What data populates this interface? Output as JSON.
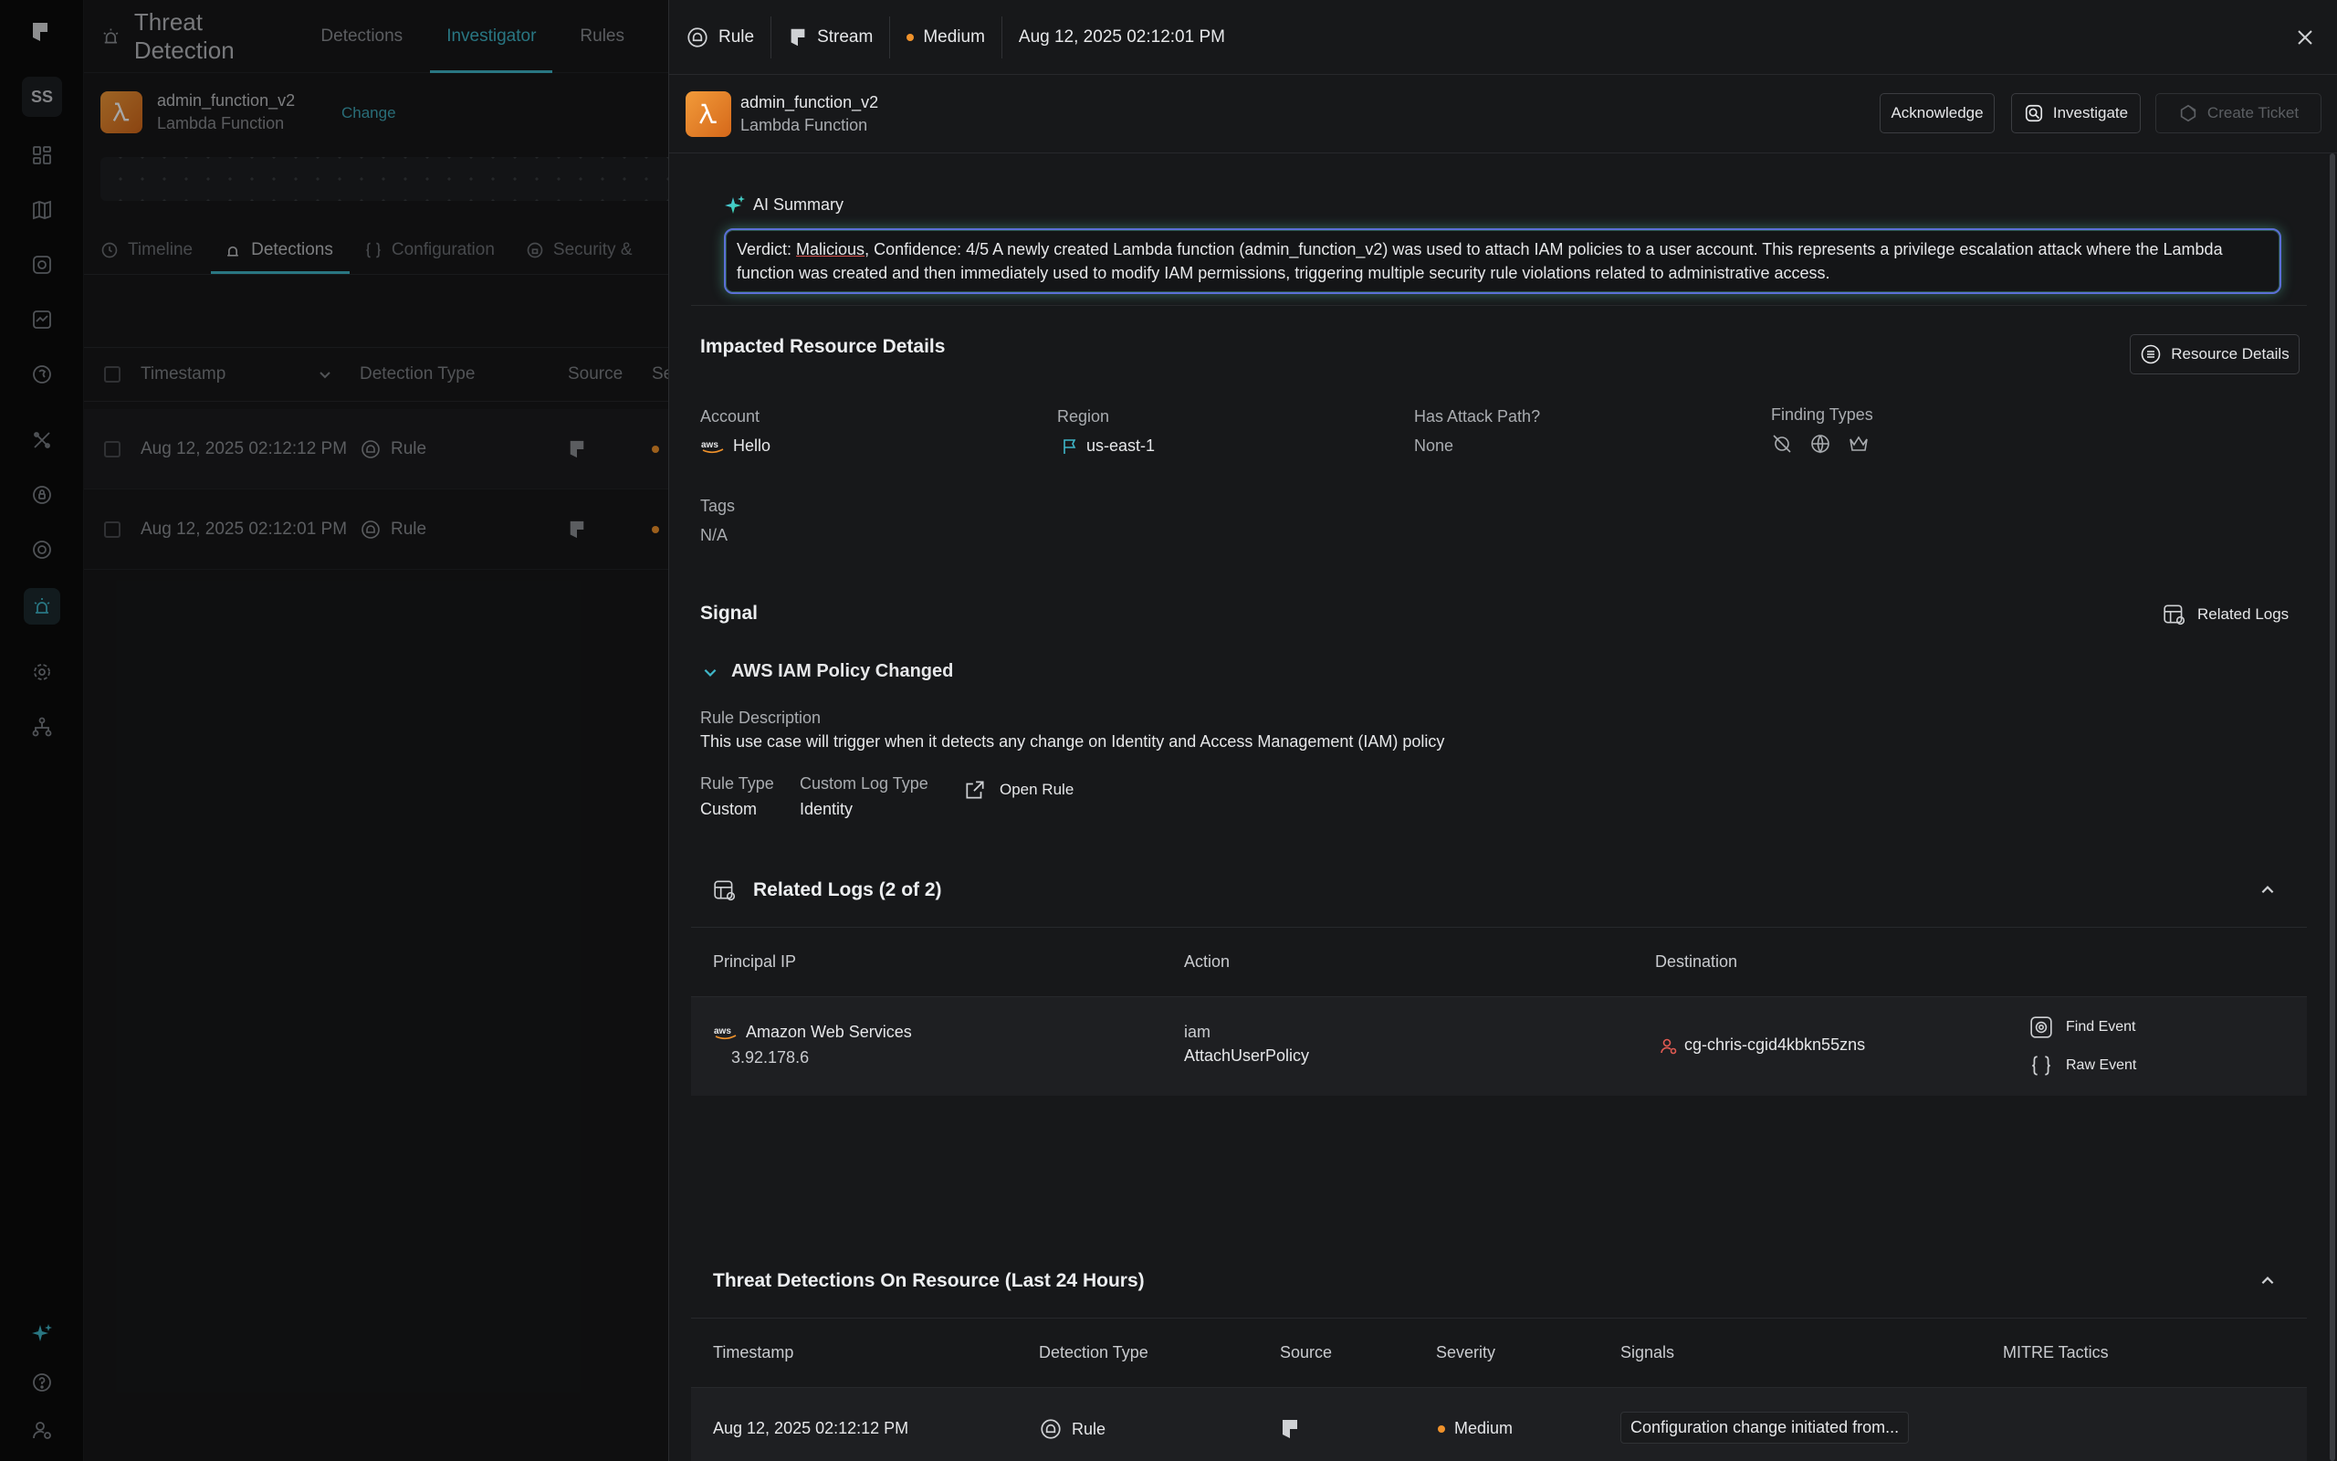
{
  "rail": {
    "avatar": "SS"
  },
  "background": {
    "app_title": "Threat Detection",
    "tabs": [
      "Detections",
      "Investigator",
      "Rules"
    ],
    "resource": {
      "name": "admin_function_v2",
      "type": "Lambda Function",
      "change": "Change"
    },
    "subtabs": [
      "Timeline",
      "Detections",
      "Configuration",
      "Security &"
    ],
    "table": {
      "columns": [
        "Timestamp",
        "Detection Type",
        "Source",
        "Se"
      ],
      "rows": [
        {
          "timestamp": "Aug 12, 2025 02:12:12 PM",
          "type": "Rule"
        },
        {
          "timestamp": "Aug 12, 2025 02:12:01 PM",
          "type": "Rule"
        }
      ]
    }
  },
  "drawer": {
    "top": {
      "kind": "Rule",
      "source": "Stream",
      "severity": "Medium",
      "timestamp": "Aug 12, 2025 02:12:01 PM"
    },
    "resource": {
      "name": "admin_function_v2",
      "type": "Lambda Function"
    },
    "buttons": {
      "acknowledge": "Acknowledge",
      "investigate": "Investigate",
      "create_ticket": "Create Ticket"
    },
    "ai": {
      "title": "AI Summary",
      "prefix": "Verdict: ",
      "verdict": "Malicious",
      "text": ", Confidence: 4/5 A newly created Lambda function (admin_function_v2) was used to attach IAM policies to a user account. This represents a privilege escalation attack where the Lambda function was created and then immediately used to modify IAM permissions, triggering multiple security rule violations related to administrative access."
    },
    "impacted": {
      "title": "Impacted Resource Details",
      "button": "Resource Details",
      "account_label": "Account",
      "account_value": "Hello",
      "region_label": "Region",
      "region_value": "us-east-1",
      "attack_label": "Has Attack Path?",
      "attack_value": "None",
      "finding_label": "Finding Types",
      "tags_label": "Tags",
      "tags_value": "N/A"
    },
    "signal": {
      "title": "Signal",
      "related_logs_button": "Related Logs",
      "name": "AWS IAM Policy Changed",
      "desc_label": "Rule Description",
      "desc_value": "This use case will trigger when it detects any change on Identity and Access Management (IAM) policy",
      "rule_type_label": "Rule Type",
      "rule_type_value": "Custom",
      "log_type_label": "Custom Log Type",
      "log_type_value": "Identity",
      "open_rule": "Open Rule"
    },
    "related_logs": {
      "title": "Related Logs (2 of 2)",
      "columns": [
        "Principal IP",
        "Action",
        "Destination"
      ],
      "row": {
        "principal": "Amazon Web Services",
        "ip": "3.92.178.6",
        "action_service": "iam",
        "action": "AttachUserPolicy",
        "destination": "cg-chris-cgid4kbkn55zns",
        "find_event": "Find Event",
        "raw_event": "Raw Event"
      }
    },
    "threats": {
      "title": "Threat Detections On Resource (Last 24 Hours)",
      "columns": [
        "Timestamp",
        "Detection Type",
        "Source",
        "Severity",
        "Signals",
        "MITRE Tactics"
      ],
      "row": {
        "timestamp": "Aug 12, 2025 02:12:12 PM",
        "type": "Rule",
        "severity": "Medium",
        "signals": "Configuration change initiated from..."
      }
    }
  },
  "colors": {
    "accent": "#3fb6c8",
    "severity_medium": "#f0922b",
    "lambda": "#e57f27"
  }
}
